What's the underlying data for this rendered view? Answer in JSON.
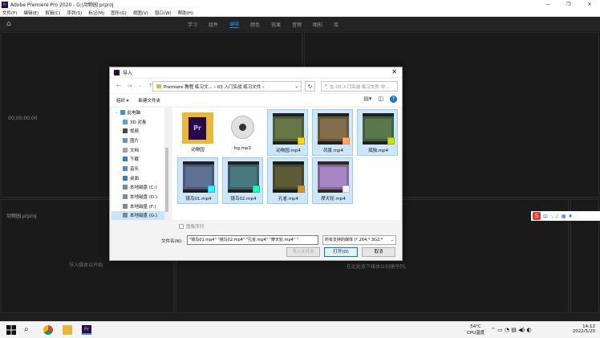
{
  "app": {
    "title": "Adobe Premiere Pro 2020 - G:\\动物园.prproj",
    "menus": [
      "文件(F)",
      "编辑(E)",
      "剪辑(C)",
      "序列(S)",
      "标记(M)",
      "图形(G)",
      "视图(V)",
      "窗口(W)",
      "帮助(H)"
    ],
    "workspaces": [
      "学习",
      "组件",
      "编辑",
      "颜色",
      "效果",
      "音频",
      "图形",
      "库"
    ],
    "active_workspace": "编辑",
    "timecode_left": "00;00;00;00",
    "project_panel": "动物园.prproj",
    "project_hint": "导入媒体以开始",
    "timeline_hint": "在此处放下媒体以创建序列。"
  },
  "dialog": {
    "title": "导入",
    "path": "Premiere 教程 练习文… › 03 入门实战 练习文件 ›",
    "search_placeholder": "在 03 入门实战 练习文件 中...",
    "organize_label": "组织 ▾",
    "new_folder_label": "新建文件夹",
    "nav_items": [
      {
        "label": "此电脑",
        "icon": "computer-icon",
        "selected": false
      },
      {
        "label": "3D 对象",
        "icon": "cube-icon",
        "selected": false
      },
      {
        "label": "视频",
        "icon": "video-icon",
        "selected": false
      },
      {
        "label": "图片",
        "icon": "picture-icon",
        "selected": false
      },
      {
        "label": "文档",
        "icon": "document-icon",
        "selected": false
      },
      {
        "label": "下载",
        "icon": "download-icon",
        "selected": false
      },
      {
        "label": "音乐",
        "icon": "music-icon",
        "selected": false
      },
      {
        "label": "桌面",
        "icon": "desktop-icon",
        "selected": false
      },
      {
        "label": "本地磁盘 (C:)",
        "icon": "disk-icon",
        "selected": false
      },
      {
        "label": "本地磁盘 (D:)",
        "icon": "disk-icon",
        "selected": false
      },
      {
        "label": "本地磁盘 (F:)",
        "icon": "disk-icon",
        "selected": false
      },
      {
        "label": "本地磁盘 (G:)",
        "icon": "disk-icon",
        "selected": true
      }
    ],
    "files": [
      {
        "name": "动物园",
        "kind": "prproj",
        "selected": false
      },
      {
        "name": "bg.mp3",
        "kind": "audio",
        "selected": false
      },
      {
        "name": "动物园.mp4",
        "kind": "video",
        "selected": true
      },
      {
        "name": "风景.mp4",
        "kind": "video",
        "selected": true
      },
      {
        "name": "孤独.mp4",
        "kind": "video",
        "selected": true
      },
      {
        "name": "镜鸟01.mp4",
        "kind": "video",
        "selected": true
      },
      {
        "name": "镜鸟02.mp4",
        "kind": "video",
        "selected": true
      },
      {
        "name": "孔雀.mp4",
        "kind": "video",
        "selected": true
      },
      {
        "name": "摩天轮.mp4",
        "kind": "video",
        "selected": true
      }
    ],
    "image_sequence_label": "图像序列",
    "filename_label": "文件名(N):",
    "filename_value": "\"镜鸟01.mp4\" \"镜鸟02.mp4\" \"孔雀.mp4\" \"摩天轮.mp4\" \"",
    "filetype_value": "所有支持的媒体 (*.264;*.3G2;*",
    "import_folder_label": "导入文件夹",
    "open_label": "打开(O)",
    "cancel_label": "取消"
  },
  "taskbar": {
    "weather_temp": "54°C",
    "weather_desc": "CPU温度",
    "time": "14:12",
    "date": "2022/5/20"
  },
  "ime": {
    "lang": "中"
  }
}
